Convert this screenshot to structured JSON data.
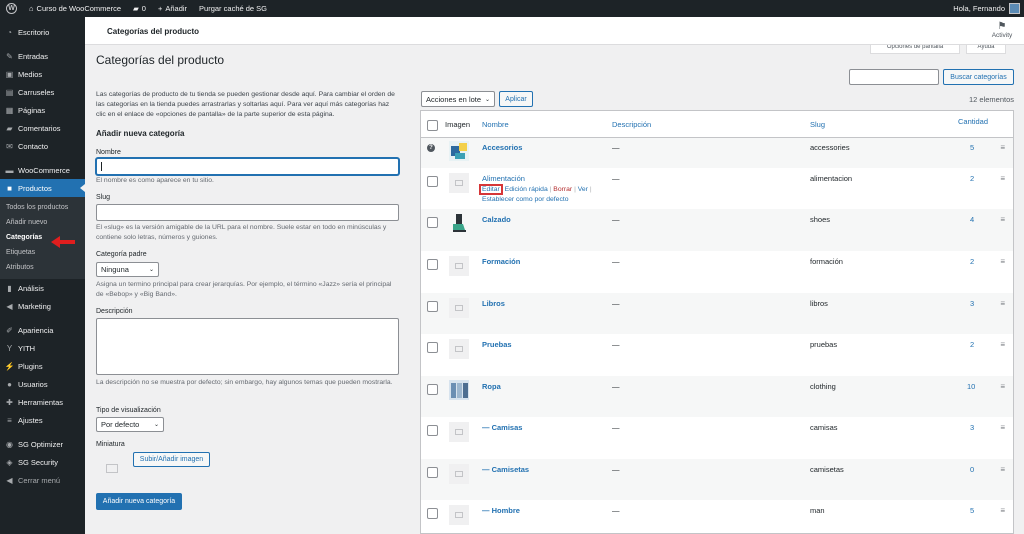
{
  "adminbar": {
    "site_name": "Curso de WooCommerce",
    "comments_count": "0",
    "add_new": "Añadir",
    "purge_cache": "Purgar caché de SG",
    "greeting": "Hola, Fernando"
  },
  "sidebar": {
    "items": [
      {
        "label": "Escritorio",
        "icon": "dashboard-icon"
      },
      {
        "label": "Entradas",
        "icon": "pin-icon"
      },
      {
        "label": "Medios",
        "icon": "media-icon"
      },
      {
        "label": "Carruseles",
        "icon": "carousel-icon"
      },
      {
        "label": "Páginas",
        "icon": "pages-icon"
      },
      {
        "label": "Comentarios",
        "icon": "comments-icon"
      },
      {
        "label": "Contacto",
        "icon": "mail-icon"
      },
      {
        "label": "WooCommerce",
        "icon": "woo-icon"
      },
      {
        "label": "Productos",
        "icon": "box-icon"
      },
      {
        "label": "Análisis",
        "icon": "chart-icon"
      },
      {
        "label": "Marketing",
        "icon": "megaphone-icon"
      },
      {
        "label": "Apariencia",
        "icon": "brush-icon"
      },
      {
        "label": "YITH",
        "icon": "yith-icon"
      },
      {
        "label": "Plugins",
        "icon": "plug-icon"
      },
      {
        "label": "Usuarios",
        "icon": "user-icon"
      },
      {
        "label": "Herramientas",
        "icon": "wrench-icon"
      },
      {
        "label": "Ajustes",
        "icon": "settings-icon"
      },
      {
        "label": "SG Optimizer",
        "icon": "sg-icon"
      },
      {
        "label": "SG Security",
        "icon": "shield-icon"
      },
      {
        "label": "Cerrar menú",
        "icon": "collapse-icon"
      }
    ],
    "submenu": [
      "Todos los productos",
      "Añadir nuevo",
      "Categorías",
      "Etiquetas",
      "Atributos"
    ]
  },
  "header": {
    "title": "Categorías del producto",
    "activity": "Activity",
    "screen_options": "Opciones de pantalla",
    "help": "Ayuda"
  },
  "page": {
    "title": "Categorías del producto",
    "search_button": "Buscar categorías",
    "search_placeholder": "",
    "intro": "Las categorías de producto de tu tienda se pueden gestionar desde aquí. Para cambiar el orden de las categorías en la tienda puedes arrastrarlas y soltarlas aquí. Para ver aquí más categorías haz clic en el enlace de «opciones de pantalla» de la parte superior de esta página."
  },
  "form": {
    "heading": "Añadir nueva categoría",
    "name_label": "Nombre",
    "name_help": "El nombre es como aparece en tu sitio.",
    "slug_label": "Slug",
    "slug_help": "El «slug» es la versión amigable de la URL para el nombre. Suele estar en todo en minúsculas y contiene solo letras, números y guiones.",
    "parent_label": "Categoría padre",
    "parent_value": "Ninguna",
    "parent_help": "Asigna un termino principal para crear jerarquías. Por ejemplo, el término «Jazz» sería el principal de «Bebop» y «Big Band».",
    "desc_label": "Descripción",
    "desc_help": "La descripción no se muestra por defecto; sin embargo, hay algunos temas que pueden mostrarla.",
    "display_label": "Tipo de visualización",
    "display_value": "Por defecto",
    "thumb_label": "Miniatura",
    "upload_button": "Subir/Añadir imagen",
    "submit": "Añadir nueva categoría"
  },
  "table": {
    "bulk_select": "Acciones en lote",
    "apply": "Aplicar",
    "count": "12 elementos",
    "columns": {
      "image": "Imagen",
      "name": "Nombre",
      "description": "Descripción",
      "slug": "Slug",
      "count": "Cantidad"
    },
    "row_actions": {
      "edit": "Editar",
      "quick_edit": "Edición rápida",
      "delete": "Borrar",
      "view": "Ver",
      "default": "Establecer como por defecto"
    },
    "rows": [
      {
        "name": "Accesorios",
        "desc": "—",
        "slug": "accessories",
        "count": "5",
        "thumb": "accessories"
      },
      {
        "name": "Alimentación",
        "desc": "—",
        "slug": "alimentacion",
        "count": "2",
        "thumb": "placeholder"
      },
      {
        "name": "Calzado",
        "desc": "—",
        "slug": "shoes",
        "count": "4",
        "thumb": "shoes"
      },
      {
        "name": "Formación",
        "desc": "—",
        "slug": "formación",
        "count": "2",
        "thumb": "placeholder"
      },
      {
        "name": "Libros",
        "desc": "—",
        "slug": "libros",
        "count": "3",
        "thumb": "placeholder"
      },
      {
        "name": "Pruebas",
        "desc": "—",
        "slug": "pruebas",
        "count": "2",
        "thumb": "placeholder"
      },
      {
        "name": "Ropa",
        "desc": "—",
        "slug": "clothing",
        "count": "10",
        "thumb": "clothing"
      },
      {
        "name": "— Camisas",
        "desc": "—",
        "slug": "camisas",
        "count": "3",
        "thumb": "placeholder"
      },
      {
        "name": "— Camisetas",
        "desc": "—",
        "slug": "camisetas",
        "count": "0",
        "thumb": "placeholder"
      },
      {
        "name": "— Hombre",
        "desc": "—",
        "slug": "man",
        "count": "5",
        "thumb": "placeholder"
      }
    ]
  },
  "colors": {
    "accent": "#2271b1",
    "annotation": "#d63638",
    "sidebar": "#1d2327"
  }
}
